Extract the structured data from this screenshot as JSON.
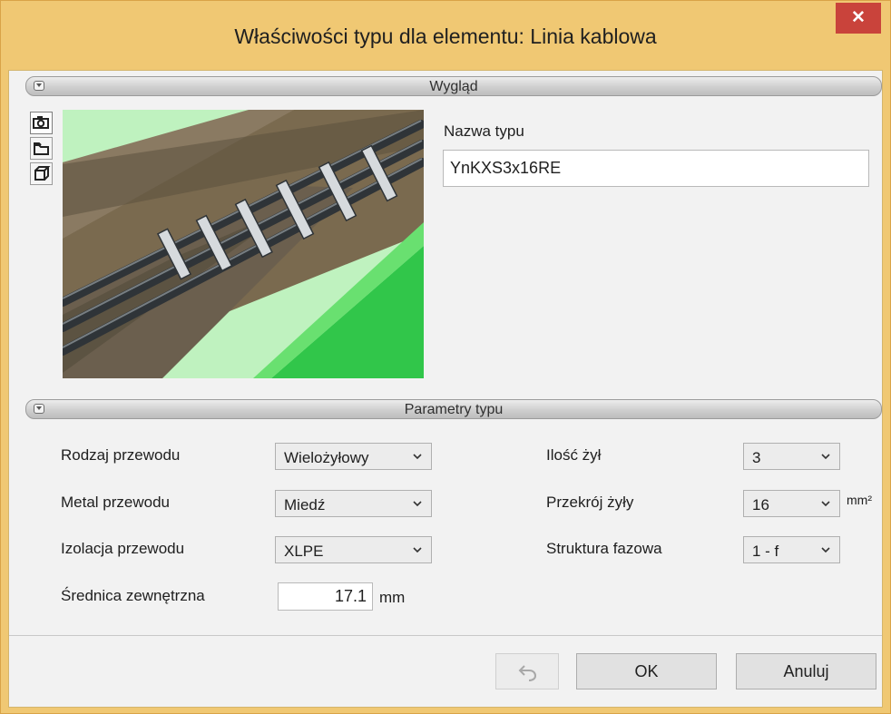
{
  "window": {
    "title": "Właściwości typu dla elementu: Linia kablowa",
    "close_label": "✕"
  },
  "appearance": {
    "section_title": "Wygląd",
    "tools": [
      "camera-icon",
      "folder-icon",
      "cube-icon"
    ],
    "type_name_label": "Nazwa typu",
    "type_name_value": "YnKXS3x16RE"
  },
  "parameters": {
    "section_title": "Parametry typu",
    "wire_kind_label": "Rodzaj przewodu",
    "wire_kind_value": "Wielożyłowy",
    "wire_metal_label": "Metal przewodu",
    "wire_metal_value": "Miedź",
    "insulation_label": "Izolacja przewodu",
    "insulation_value": "XLPE",
    "outer_diameter_label": "Średnica zewnętrzna",
    "outer_diameter_value": "17.1",
    "outer_diameter_unit": "mm",
    "core_count_label": "Ilość żył",
    "core_count_value": "3",
    "core_cross_section_label": "Przekrój żyły",
    "core_cross_section_value": "16",
    "core_cross_section_unit": "mm²",
    "phase_structure_label": "Struktura fazowa",
    "phase_structure_value": "1 - f"
  },
  "footer": {
    "ok_label": "OK",
    "cancel_label": "Anuluj",
    "undo_icon": "undo-icon"
  },
  "colors": {
    "title_bar": "#f0c873",
    "close_button": "#c9433b",
    "section_bar": "#cfcfcf",
    "grass": "#66d96b"
  }
}
